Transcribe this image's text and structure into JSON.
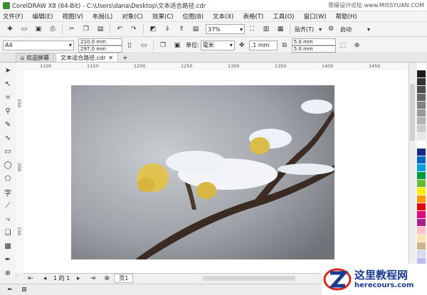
{
  "window": {
    "title": "CorelDRAW X8 (64-Bit) - C:\\Users\\dana\\Desktop\\文本适合路径.cdr",
    "watermark": "思缘设计论坛 www.MISSYUAN.COM"
  },
  "menu": [
    "文件(F)",
    "编辑(E)",
    "视图(V)",
    "布局(L)",
    "对象(C)",
    "效果(C)",
    "位图(B)",
    "文本(X)",
    "表格(T)",
    "工具(O)",
    "窗口(W)",
    "帮助(H)"
  ],
  "toolbar1": {
    "zoom": "37%",
    "snap_label": "贴齐(T)",
    "launch_label": "启动"
  },
  "toolbar2": {
    "page_size": "A4",
    "width": "210.0 mm",
    "height": "297.0 mm",
    "unit_label": "单位:",
    "unit": "毫米",
    "nudge": ".1 mm",
    "dup_x": "5.0 mm",
    "dup_y": "5.0 mm"
  },
  "tabs": [
    {
      "label": "欢迎屏幕"
    },
    {
      "label": "文本适合路径.cdr"
    }
  ],
  "ruler": {
    "h_ticks": [
      "1100",
      "1150",
      "1200",
      "1250",
      "1300",
      "1350",
      "1400",
      "1450"
    ],
    "v_ticks": [
      "250",
      "200",
      "150"
    ]
  },
  "pagebar": {
    "page_count": "1 的 1",
    "page_tab": "页1"
  },
  "branding": {
    "cn": "这里教程网",
    "en": "herecours.com"
  },
  "palette_colors": [
    "#ffffff",
    "#1a1a1a",
    "#333333",
    "#4d4d4d",
    "#666666",
    "#808080",
    "#999999",
    "#b3b3b3",
    "#cccccc",
    "#e6e6e6",
    "#ffffff",
    "#1a2a8c",
    "#0066cc",
    "#00a0e0",
    "#009944",
    "#66bb33",
    "#ffee00",
    "#ff9900",
    "#e60012",
    "#e4007f",
    "#aa2288",
    "#ffc0cb",
    "#ffe4b5",
    "#d2b48c",
    "#d9d9f3",
    "#bbbbee"
  ]
}
